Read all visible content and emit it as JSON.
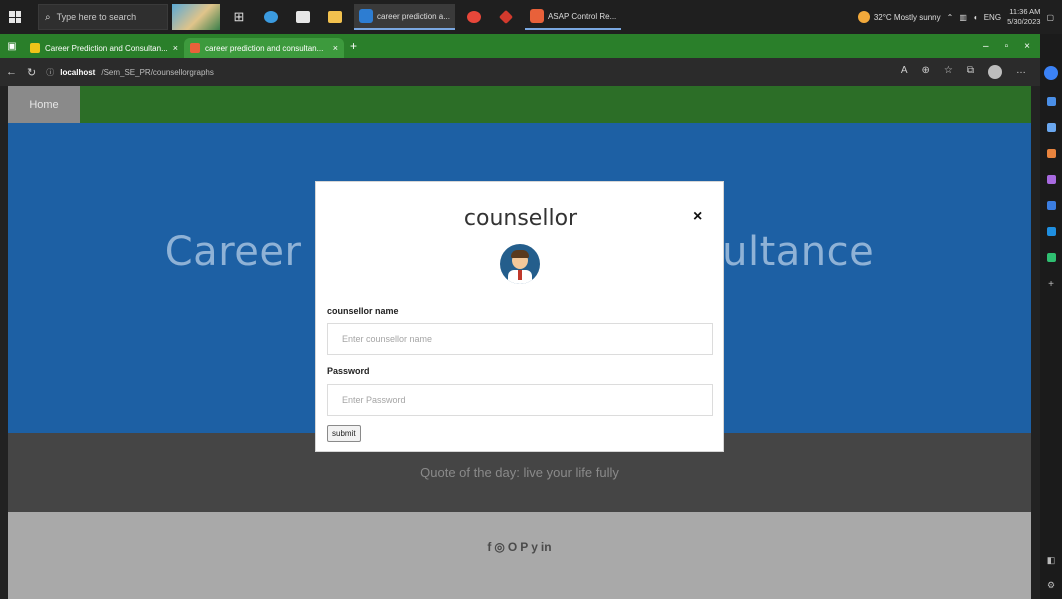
{
  "taskbar": {
    "search_placeholder": "Type here to search",
    "apps": [
      {
        "label": "career prediction a...",
        "color": "#2d7dd2"
      },
      {
        "label": "ASAP Control Re...",
        "color": "#e8613a"
      }
    ],
    "weather": "32°C  Mostly sunny",
    "language": "ENG",
    "time": "11:36 AM",
    "date": "5/30/2023"
  },
  "browser": {
    "tabs": [
      {
        "label": "Career Prediction and Consultan...",
        "color": "#f0c419"
      },
      {
        "label": "career prediction and consultan...",
        "color": "#e8613a"
      }
    ],
    "url_host": "localhost",
    "url_path": "/Sem_SE_PR/counsellorgraphs"
  },
  "page": {
    "nav_home": "Home",
    "hero_title": "Career Prediction and Consultance",
    "quote": "Quote of the day: live your life fully",
    "social_icons": [
      "facebook-icon",
      "instagram-icon",
      "github-icon",
      "pinterest-icon",
      "twitter-icon",
      "linkedin-icon"
    ],
    "social_glyphs": [
      "f",
      "◎",
      "O",
      "P",
      "y",
      "in"
    ]
  },
  "modal": {
    "title": "counsellor",
    "close": "×",
    "name_label": "counsellor name",
    "name_placeholder": "Enter counsellor name",
    "password_label": "Password",
    "password_placeholder": "Enter Password",
    "submit": "submit"
  },
  "colors": {
    "nav_green": "#2c6e27",
    "hero_blue": "#1d60a4",
    "tabbar_green": "#2a7f2a"
  }
}
